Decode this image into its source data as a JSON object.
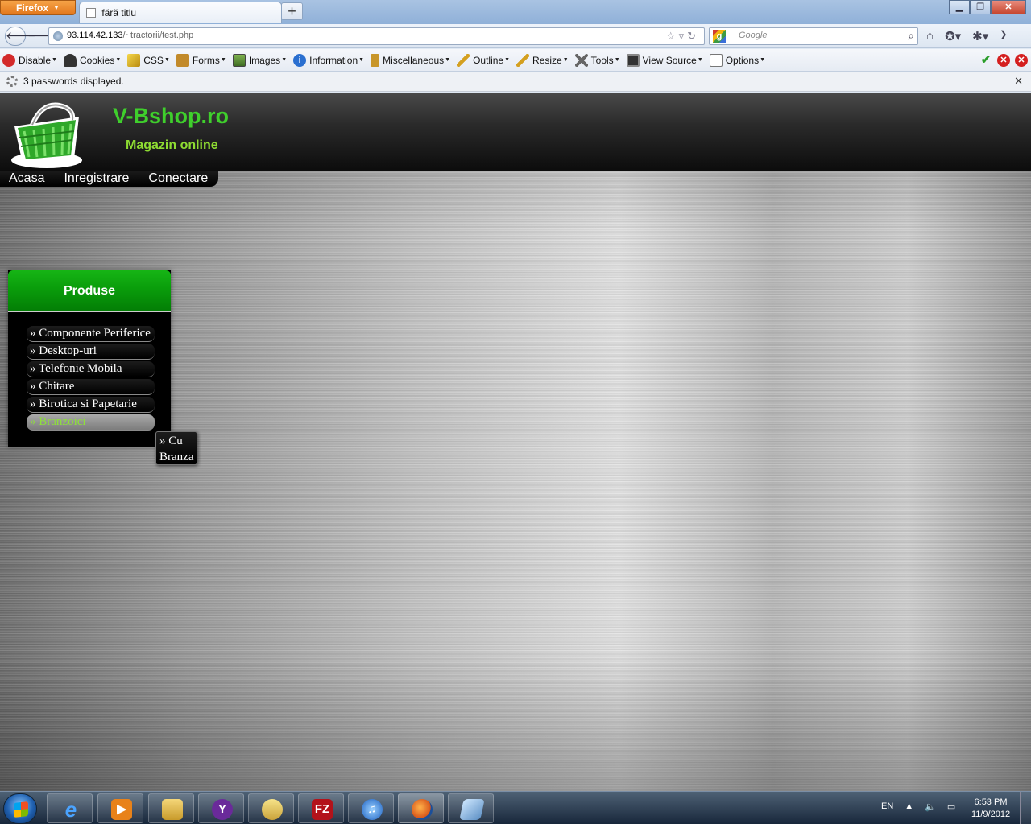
{
  "browser": {
    "app_button": "Firefox",
    "tab_title": "fără titlu",
    "url_host": "93.114.42.133",
    "url_path": "/~tractorii/test.php",
    "search_placeholder": "Google"
  },
  "dev_toolbar": {
    "items": [
      {
        "label": "Disable",
        "icon": "disable-icon",
        "color": "#d32a2a"
      },
      {
        "label": "Cookies",
        "icon": "cookies-icon",
        "color": "#333333"
      },
      {
        "label": "CSS",
        "icon": "css-icon",
        "color": "#e8c23a"
      },
      {
        "label": "Forms",
        "icon": "forms-icon",
        "color": "#c28a2a"
      },
      {
        "label": "Images",
        "icon": "images-icon",
        "color": "#5a8a3a"
      },
      {
        "label": "Information",
        "icon": "information-icon",
        "color": "#2a6fd0"
      },
      {
        "label": "Miscellaneous",
        "icon": "miscellaneous-icon",
        "color": "#c8962a"
      },
      {
        "label": "Outline",
        "icon": "outline-icon",
        "color": "#d4a020"
      },
      {
        "label": "Resize",
        "icon": "resize-icon",
        "color": "#d4a020"
      },
      {
        "label": "Tools",
        "icon": "tools-icon",
        "color": "#666666"
      },
      {
        "label": "View Source",
        "icon": "view-source-icon",
        "color": "#333333"
      },
      {
        "label": "Options",
        "icon": "options-icon",
        "color": "#777777"
      }
    ]
  },
  "notification": {
    "text": "3 passwords displayed."
  },
  "site": {
    "title": "V-Bshop.ro",
    "subtitle": "Magazin online",
    "accent": "#3fcf2c",
    "menu": [
      "Acasa",
      "Inregistrare",
      "Conectare"
    ],
    "panel_title": "Produse",
    "categories": [
      "» Componente Periferice",
      "» Desktop-uri",
      "» Telefonie Mobila",
      "» Chitare",
      "» Birotica si Papetarie",
      "» Branzoici"
    ],
    "active_category": "» Branzoici",
    "submenu": [
      "» Cu",
      "Branza"
    ]
  },
  "taskbar": {
    "language": "EN",
    "time": "6:53 PM",
    "date": "11/9/2012",
    "apps": [
      "internet-explorer-icon",
      "media-player-icon",
      "file-explorer-icon",
      "yahoo-messenger-icon",
      "teapot-app-icon",
      "filezilla-icon",
      "itunes-icon",
      "firefox-icon",
      "tablet-app-icon"
    ]
  }
}
